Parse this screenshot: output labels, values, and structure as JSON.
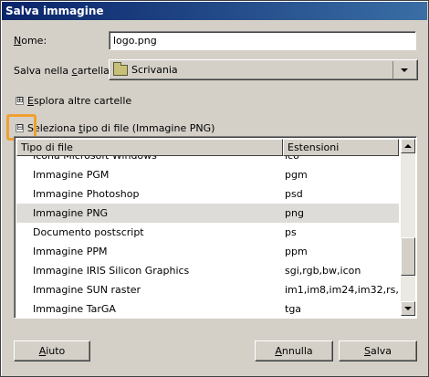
{
  "window": {
    "title": "Salva immagine"
  },
  "name_field": {
    "label_access": "N",
    "label_rest": "ome:",
    "value": "logo.png"
  },
  "folder_field": {
    "label_pre": "Salva nella ",
    "label_access": "c",
    "label_rest": "artella:",
    "value": "Scrivania"
  },
  "browse_expander": {
    "symbol": "⊞",
    "label_access": "E",
    "label_rest": "splora altre cartelle"
  },
  "filetype_expander": {
    "symbol": "⊟",
    "label_pre": "Seleziona ",
    "label_access": "t",
    "label_rest": "ipo di file (Immagine PNG)"
  },
  "filetype_list": {
    "columns": [
      "Tipo di file",
      "Estensioni"
    ],
    "rows": [
      {
        "type": "Icona Microsoft Windows",
        "ext": "ico"
      },
      {
        "type": "Immagine PGM",
        "ext": "pgm"
      },
      {
        "type": "Immagine Photoshop",
        "ext": "psd"
      },
      {
        "type": "Immagine PNG",
        "ext": "png",
        "selected": true
      },
      {
        "type": "Documento postscript",
        "ext": "ps"
      },
      {
        "type": "Immagine PPM",
        "ext": "ppm"
      },
      {
        "type": "Immagine IRIS Silicon Graphics",
        "ext": "sgi,rgb,bw,icon"
      },
      {
        "type": "Immagine SUN raster",
        "ext": "im1,im8,im24,im32,rs,ras"
      },
      {
        "type": "Immagine TarGA",
        "ext": "tga"
      }
    ]
  },
  "buttons": {
    "help_access": "A",
    "help_rest": "iuto",
    "cancel_access": "A",
    "cancel_rest": "nnulla",
    "save_access": "S",
    "save_rest": "alva"
  },
  "colors": {
    "titlebar": "#0a246a",
    "highlight": "#f0a030",
    "selected_row": "#dedcd8"
  }
}
